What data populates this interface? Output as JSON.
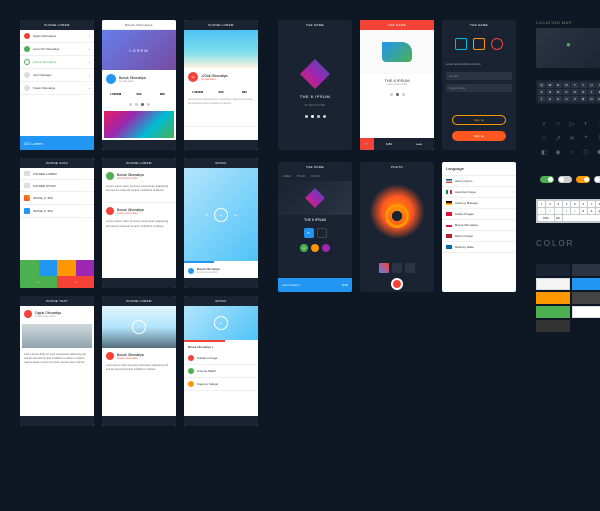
{
  "headers": {
    "phone_lorem": "PHONE LOREM",
    "phone_data": "PHONE DATA",
    "phone_text": "PHONE TEXT",
    "music": "MUSIC",
    "the_name": "THE NAME",
    "location_map": "LOCATION MAP"
  },
  "contacts": [
    "Opjuk Obonaitiya",
    "Lorem72 Obonatiya",
    "Ftotuk Obonatiya",
    "Opit Oobraga",
    "Kotuk Obonatiya"
  ],
  "action": "GO Lorem",
  "profile": {
    "name": "Bovuk Obonatiya",
    "sub": "by matt oliver",
    "stats": [
      {
        "v": "LOREM",
        "l": "ipsum"
      },
      {
        "v": "690",
        "l": "lorem"
      },
      {
        "v": "890",
        "l": "ipsum"
      }
    ]
  },
  "hero_label": "LOREM",
  "folders": [
    "FOLDER LOREM",
    "FOLDER IPSUM"
  ],
  "images": [
    "IMAGE_P JPG",
    "IMAGE_P JPG"
  ],
  "post": {
    "user": "Bovuk Obonatiya",
    "meta": "Lorem ipsum dolor",
    "body": "Lorem ipsum dolor sit amet consectetur adipiscing elit sed do eiusmod tempor incididunt ut labore"
  },
  "article": {
    "user": "Opjuk Obonatiya",
    "body": "Lorem ipsum dolor sit amet consectetur adipiscing elit sed do eiusmod tempor incididunt ut labore et dolore magna aliqua ut enim ad minim veniam quis nostrud"
  },
  "comments": [
    "Auliption Kraga",
    "Anomie Mokih",
    "Kagrosy Kalugo"
  ],
  "album": {
    "title": "THE 6 IPSUM",
    "by": "BY MATT OLIVER"
  },
  "shop": {
    "title": "THE 6 IPSUM",
    "caption": "Lorem ipsum dolor",
    "price": "$ 80",
    "old": "$ 90"
  },
  "sizes": [
    "A",
    "B",
    "C"
  ],
  "auth": {
    "desc": "Lorem Ipsum Dolor sit Amet",
    "email": "E-mail",
    "login": "Login Name",
    "signup": "Sign up",
    "su2": "Sign up"
  },
  "lorem_block": "Lorem Ipsum",
  "price2": "$ 80",
  "photo": "PHOTO",
  "lang_title": "Language",
  "langs": [
    "Aleom ipsum",
    "Autoritys Kraga",
    "Andomy Bulaugo",
    "Anitax Kragae",
    "Bovuk Obonatiya",
    "Ditono Fopait",
    "Defonsy Halte"
  ],
  "kb_rows": [
    [
      "Q",
      "W",
      "E",
      "R",
      "T",
      "Y",
      "U",
      "I",
      "O",
      "P"
    ],
    [
      "A",
      "S",
      "D",
      "F",
      "G",
      "H",
      "J",
      "K",
      "L"
    ],
    [
      "Z",
      "X",
      "C",
      "V",
      "B",
      "N",
      "M"
    ]
  ],
  "kb2": [
    [
      "1",
      "2",
      "3",
      "4",
      "5",
      "6",
      "7",
      "8",
      "9",
      "0"
    ],
    [
      "-",
      "/",
      ";",
      "(",
      ")",
      "$",
      "&",
      "@",
      "\""
    ],
    [
      "ABC",
      "EN",
      " ",
      "↵"
    ]
  ],
  "color_title": "COLOR",
  "colors": [
    "#1a2332",
    "#2a3442",
    "#f5f5f5",
    "#ffffff",
    "#2196f3",
    "#4caf50",
    "#ff9800",
    "#444"
  ]
}
